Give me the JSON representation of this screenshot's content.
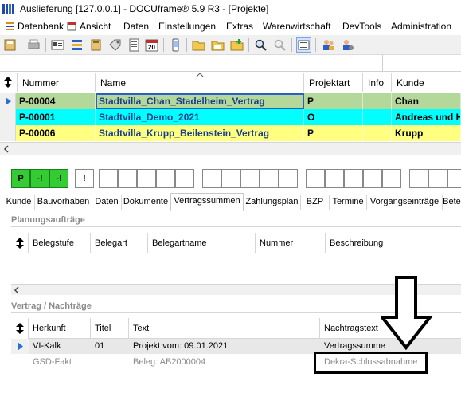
{
  "window": {
    "title": "Auslieferung [127.0.0.1] - DOCUframe® 5.9 R3 - [Projekte]"
  },
  "menu": [
    {
      "label": "Datenbank",
      "icon": "database-menu-icon"
    },
    {
      "label": "Ansicht",
      "icon": "view-menu-icon"
    },
    {
      "label": "Daten"
    },
    {
      "label": "Einstellungen"
    },
    {
      "label": "Extras"
    },
    {
      "label": "Warenwirtschaft"
    },
    {
      "label": "DevTools"
    },
    {
      "label": "Administration"
    }
  ],
  "toolbar": {
    "icons": [
      "save-icon",
      "print-icon",
      "id-card-icon",
      "list-icon",
      "book-icon",
      "tag-icon",
      "document-icon",
      "calendar-icon",
      "phone-icon",
      "folder-icon",
      "folder-open-icon",
      "folder-add-icon",
      "search-icon",
      "search-disabled-icon",
      "layout-icon",
      "users-icon",
      "user-settings-icon"
    ],
    "calendar_day": "20"
  },
  "project_grid": {
    "columns": [
      "Nummer",
      "Name",
      "Projektart",
      "Info",
      "Kunde"
    ],
    "rows": [
      {
        "nummer": "P-00004",
        "name": "Stadtvilla_Chan_Stadelheim_Vertrag",
        "projektart": "P",
        "info": "",
        "kunde": "Chan",
        "color": "#b4d89a",
        "selected": true
      },
      {
        "nummer": "P-00001",
        "name": "Stadtvilla_Demo_2021",
        "projektart": "O",
        "info": "",
        "kunde": "Andreas und He",
        "color": "#00ffff",
        "selected": false
      },
      {
        "nummer": "P-00006",
        "name": "Stadtvilla_Krupp_Beilenstein_Vertrag",
        "projektart": "P",
        "info": "",
        "kunde": "Krupp",
        "color": "#ffff80",
        "selected": false
      }
    ]
  },
  "status_boxes": [
    "P",
    "-!",
    "-!",
    "!"
  ],
  "tabs": [
    {
      "label": "Kunde"
    },
    {
      "label": "Bauvorhaben"
    },
    {
      "label": "Daten"
    },
    {
      "label": "Dokumente"
    },
    {
      "label": "Vertragssummen",
      "active": true
    },
    {
      "label": "Zahlungsplan"
    },
    {
      "label": "BZP"
    },
    {
      "label": "Termine"
    },
    {
      "label": "Vorgangseinträge"
    },
    {
      "label": "Bete"
    }
  ],
  "planungsauftraege": {
    "title": "Planungsaufträge",
    "columns": [
      "Belegstufe",
      "Belegart",
      "Belegartname",
      "Nummer",
      "Beschreibung"
    ]
  },
  "nachtraege": {
    "title": "Vertrag / Nachträge",
    "columns": [
      "Herkunft",
      "Titel",
      "Text",
      "Nachtragstext"
    ],
    "rows": [
      {
        "herkunft": "VI-Kalk",
        "titel": "01",
        "text": "Projekt vom: 09.01.2021",
        "nachtragstext": "Vertragssumme",
        "selected": true
      },
      {
        "herkunft": "GSD-Fakt",
        "titel": "",
        "text": "Beleg: AB2000004",
        "nachtragstext": "Dekra-Schlussabnahme",
        "selected": false
      }
    ]
  },
  "colors": {
    "link_blue": "#1a3e8c",
    "selection_blue": "#3a7bd5",
    "status_green": "#33cc33"
  }
}
